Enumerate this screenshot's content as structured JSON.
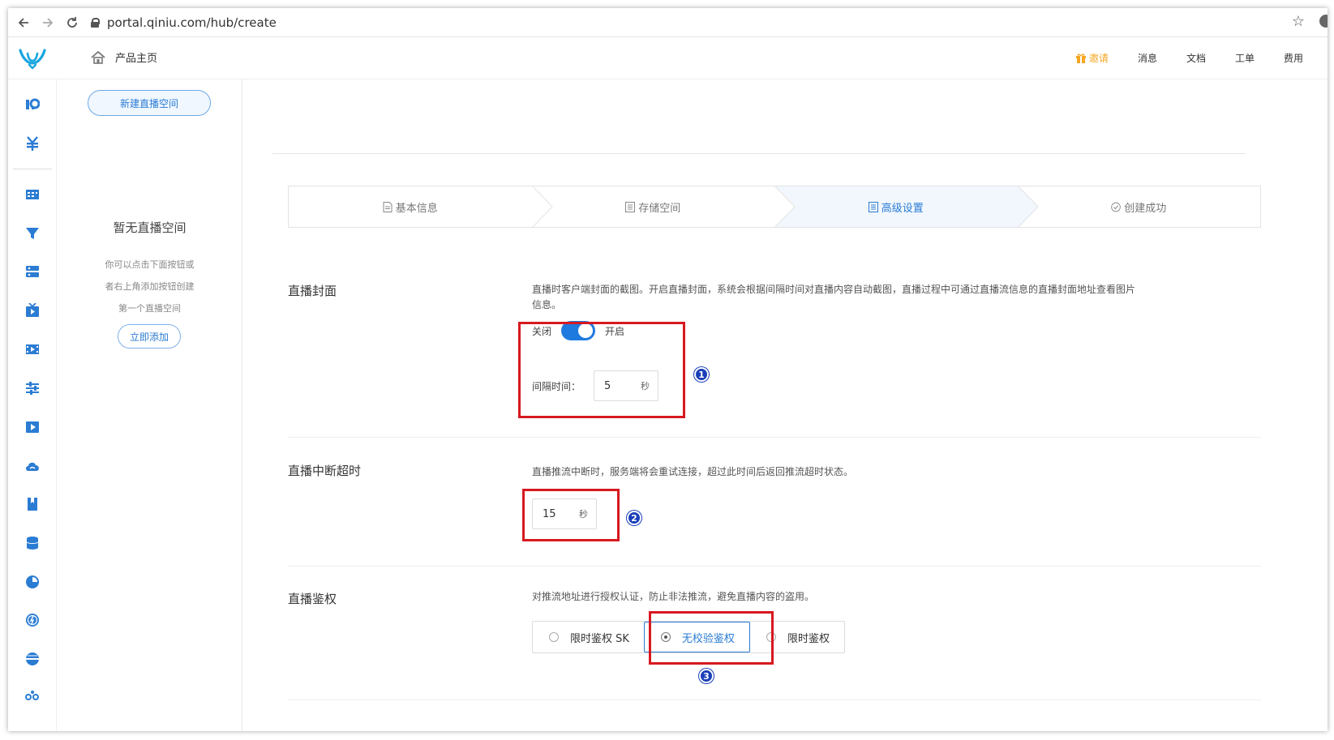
{
  "browser": {
    "url": "portal.qiniu.com/hub/create"
  },
  "header": {
    "home_label": "产品主页",
    "invite_label": "邀请",
    "messages_label": "消息",
    "docs_label": "文档",
    "tickets_label": "工单",
    "billing_label": "费用",
    "accent_color": "#2b7cd3",
    "invite_color": "#f5a623"
  },
  "rail": {
    "icons": [
      "overview-icon",
      "billing-icon",
      "storage-icon",
      "cdn-icon",
      "server-icon",
      "live-icon",
      "media-icon",
      "settings-sliders-icon",
      "video-icon",
      "cloud-icon",
      "bookmark-icon",
      "database-icon",
      "analytics-icon",
      "speed-icon",
      "network-icon",
      "more-icon"
    ]
  },
  "panel": {
    "new_space_label": "新建直播空间",
    "empty_title": "暂无直播空间",
    "empty_lines": [
      "你可以点击下面按钮或",
      "者右上角添加按钮创建",
      "第一个直播空间"
    ],
    "add_now_label": "立即添加"
  },
  "steps": [
    {
      "label": "基本信息",
      "active": false
    },
    {
      "label": "存储空间",
      "active": false
    },
    {
      "label": "高级设置",
      "active": true
    },
    {
      "label": "创建成功",
      "active": false
    }
  ],
  "cover": {
    "label": "直播封面",
    "desc_line1": "直播时客户端封面的截图。开启直播封面，系统会根据间隔时间对直播内容自动截图，直播过程中可通过直播流信息的直播封面地址查看图片",
    "desc_line2": "信息。",
    "off_label": "关闭",
    "on_label": "开启",
    "enabled": true,
    "interval_label": "间隔时间：",
    "interval_value": "5",
    "interval_unit": "秒"
  },
  "timeout": {
    "label": "直播中断超时",
    "desc": "直播推流中断时，服务端将会重试连接，超过此时间后返回推流超时状态。",
    "value": "15",
    "unit": "秒"
  },
  "auth": {
    "label": "直播鉴权",
    "desc": "对推流地址进行授权认证，防止非法推流，避免直播内容的盗用。",
    "options": [
      {
        "label": "限时鉴权 SK",
        "checked": false
      },
      {
        "label": "无校验鉴权",
        "checked": true
      },
      {
        "label": "限时鉴权",
        "checked": false
      }
    ]
  },
  "annotations": {
    "marker1": "1",
    "marker2": "2",
    "marker3": "3",
    "highlight_color": "#d71920",
    "marker_color": "#1a3fb8"
  }
}
